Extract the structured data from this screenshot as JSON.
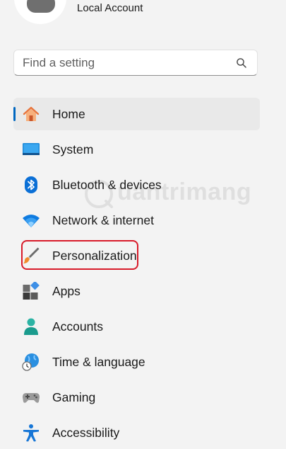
{
  "account": {
    "label": "Local Account"
  },
  "search": {
    "placeholder": "Find a setting"
  },
  "nav": {
    "items": [
      {
        "label": "Home",
        "icon": "home-icon",
        "selected": true
      },
      {
        "label": "System",
        "icon": "system-icon"
      },
      {
        "label": "Bluetooth & devices",
        "icon": "bluetooth-icon"
      },
      {
        "label": "Network & internet",
        "icon": "wifi-icon"
      },
      {
        "label": "Personalization",
        "icon": "brush-icon",
        "highlighted": true
      },
      {
        "label": "Apps",
        "icon": "apps-icon"
      },
      {
        "label": "Accounts",
        "icon": "accounts-icon"
      },
      {
        "label": "Time & language",
        "icon": "globe-clock-icon"
      },
      {
        "label": "Gaming",
        "icon": "gamepad-icon"
      },
      {
        "label": "Accessibility",
        "icon": "accessibility-icon"
      }
    ]
  },
  "watermark": {
    "text": "uantrimang"
  },
  "colors": {
    "accent": "#0067c0",
    "highlight": "#d81b2a",
    "background": "#f3f3f3"
  }
}
